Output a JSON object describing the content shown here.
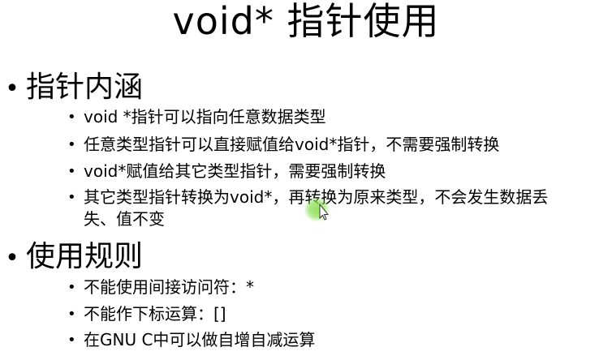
{
  "slide": {
    "title": "void* 指针使用",
    "sections": [
      {
        "heading": "指针内涵",
        "items": [
          "void *指针可以指向任意数据类型",
          "任意类型指针可以直接赋值给void*指针，不需要强制转换",
          "void*赋值给其它类型指针，需要强制转换",
          "其它类型指针转换为void*，再转换为原来类型，不会发生数据丢失、值不变"
        ]
      },
      {
        "heading": "使用规则",
        "items": [
          "不能使用间接访问符：*",
          "不能作下标运算：[]",
          "在GNU C中可以做自增自减运算"
        ]
      }
    ]
  },
  "bullets": {
    "section": "•",
    "item": "•"
  },
  "icons": {
    "cursor": "mouse-pointer-icon",
    "cursor_highlight_color": "#8fe05a"
  }
}
